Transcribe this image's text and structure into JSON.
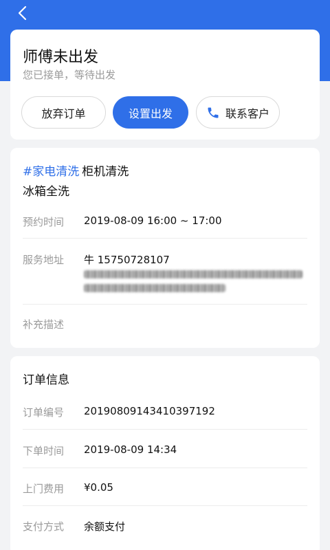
{
  "nav": {
    "back_icon": "chevron-left-icon"
  },
  "status": {
    "title": "师傅未出发",
    "subtitle": "您已接单，等待出发"
  },
  "actions": {
    "abandon_label": "放弃订单",
    "depart_label": "设置出发",
    "contact_label": "联系客户",
    "contact_icon": "phone-icon"
  },
  "service": {
    "tag": "#家电清洗",
    "name": "柜机清洗",
    "sub": "冰箱全洗",
    "appointment_label": "预约时间",
    "appointment_value": "2019-08-09 16:00 ~ 17:00",
    "address_label": "服务地址",
    "address_contact": "牛   15750728107",
    "notes_label": "补充描述"
  },
  "order": {
    "title": "订单信息",
    "rows": [
      {
        "label": "订单编号",
        "value": "20190809143410397192"
      },
      {
        "label": "下单时间",
        "value": "2019-08-09 14:34"
      },
      {
        "label": "上门费用",
        "value": "¥0.05"
      },
      {
        "label": "支付方式",
        "value": "余额支付"
      }
    ]
  },
  "colors": {
    "accent": "#2f6fe8",
    "background": "#f2f3f5",
    "muted": "#9a9a9a"
  }
}
